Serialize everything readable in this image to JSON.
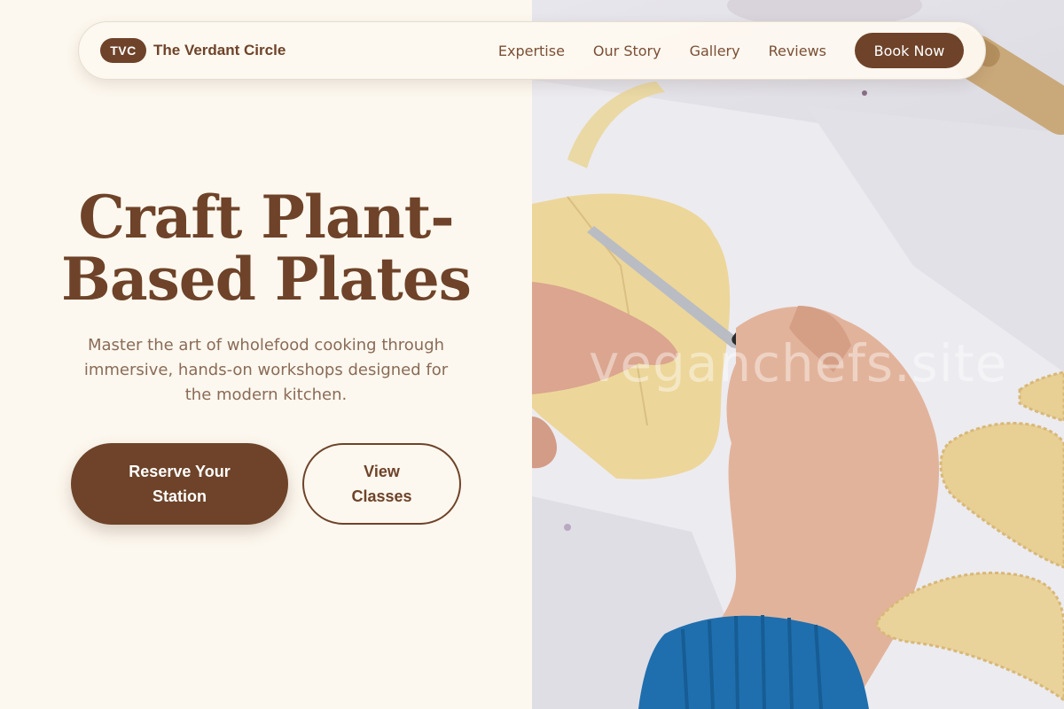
{
  "nav": {
    "badge": "TVC",
    "brand_name": "The Verdant Circle",
    "links": [
      "Expertise",
      "Our Story",
      "Gallery",
      "Reviews"
    ],
    "cta": "Book Now"
  },
  "hero": {
    "title_line1": "Craft Plant-",
    "title_line2": "Based Plates",
    "subtitle": "Master the art of wholefood cooking through immersive, hands-on workshops designed for the modern kitchen.",
    "primary_button": "Reserve Your Station",
    "secondary_button": "View Classes"
  },
  "photo": {
    "watermark": "veganchefs.site"
  },
  "colors": {
    "background": "#fdf8ef",
    "brand_brown": "#6e4329",
    "subtitle_text": "#8a6b57",
    "sweater_blue": "#1f6fae"
  }
}
